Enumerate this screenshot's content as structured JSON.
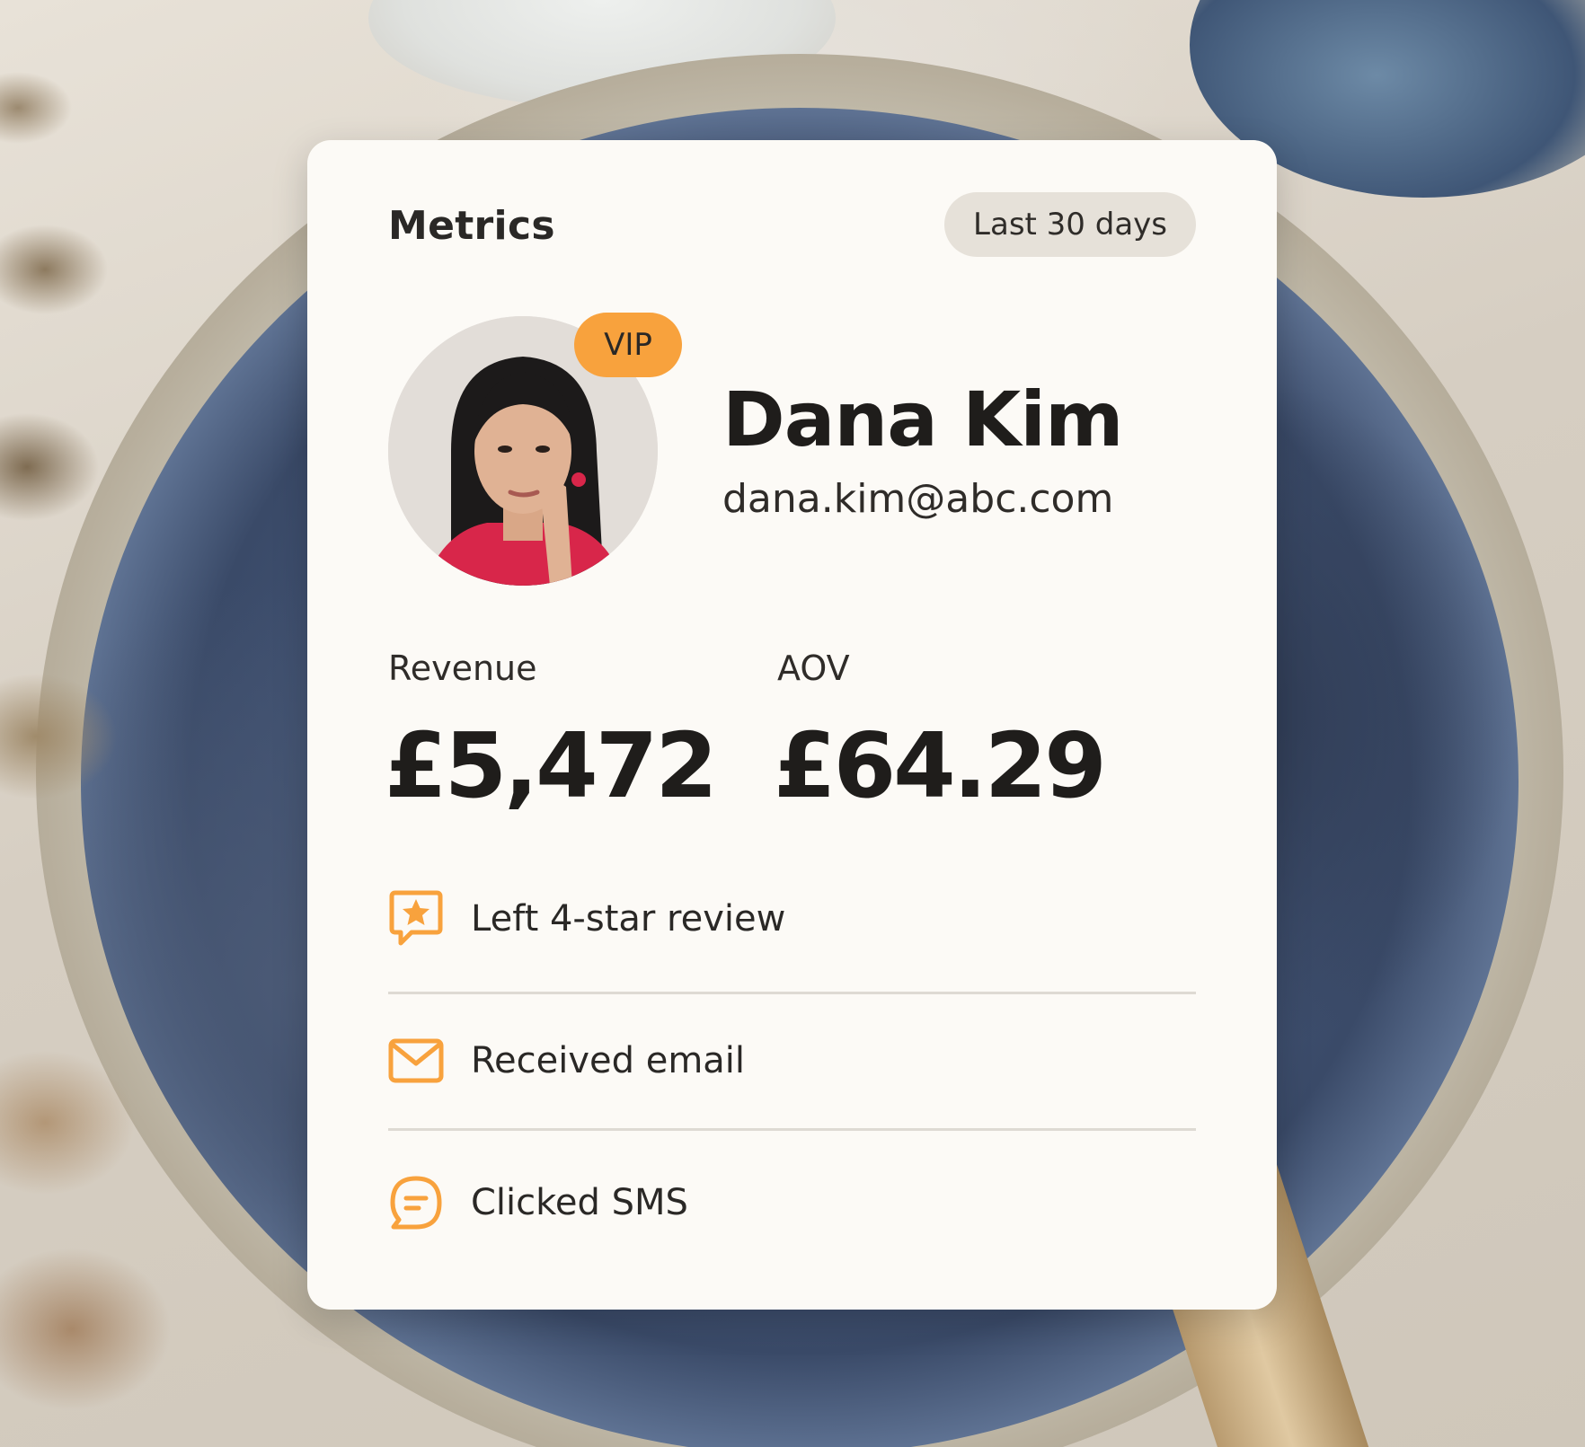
{
  "card": {
    "title": "Metrics",
    "period": "Last 30 days"
  },
  "customer": {
    "badge": "VIP",
    "name": "Dana Kim",
    "email": "dana.kim@abc.com"
  },
  "metrics": [
    {
      "label": "Revenue",
      "value": "£5,472"
    },
    {
      "label": "AOV",
      "value": "£64.29"
    }
  ],
  "activity": [
    {
      "icon": "star-review-icon",
      "text": "Left 4-star review"
    },
    {
      "icon": "email-icon",
      "text": "Received email"
    },
    {
      "icon": "sms-chat-icon",
      "text": "Clicked SMS"
    }
  ],
  "colors": {
    "accent": "#f8a23d",
    "card_bg": "#fcfaf6",
    "pill_bg": "#e6e1d9",
    "text_primary": "#1f1d1b"
  }
}
